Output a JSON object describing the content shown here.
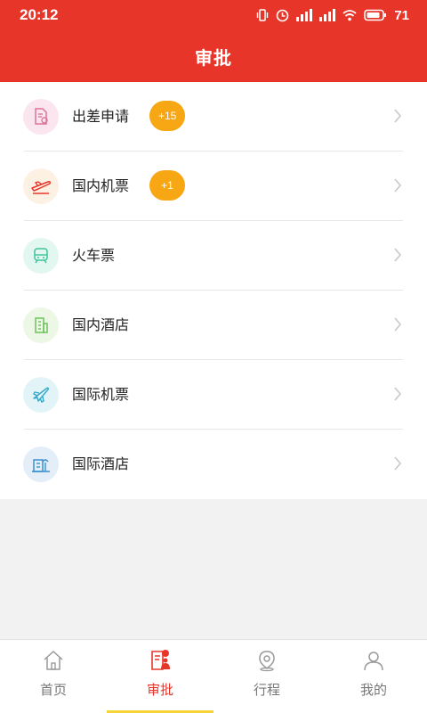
{
  "status_bar": {
    "time": "20:12",
    "battery": "71"
  },
  "header": {
    "title": "审批"
  },
  "items": [
    {
      "label": "出差申请",
      "badge": "+15",
      "icon": "document-stamp-icon",
      "icon_bg": "#fbe6ef",
      "icon_color": "#e0719c"
    },
    {
      "label": "国内机票",
      "badge": "+1",
      "icon": "plane-takeoff-icon",
      "icon_bg": "#fdf1e4",
      "icon_color": "#e8352a"
    },
    {
      "label": "火车票",
      "badge": "",
      "icon": "train-icon",
      "icon_bg": "#e3f7f1",
      "icon_color": "#3cc39a"
    },
    {
      "label": "国内酒店",
      "badge": "",
      "icon": "hotel-building-icon",
      "icon_bg": "#ecf7e6",
      "icon_color": "#6cc35a"
    },
    {
      "label": "国际机票",
      "badge": "",
      "icon": "airplane-icon",
      "icon_bg": "#e3f4f8",
      "icon_color": "#3aa9c9"
    },
    {
      "label": "国际酒店",
      "badge": "",
      "icon": "international-hotel-icon",
      "icon_bg": "#e3eef8",
      "icon_color": "#3b8fd0"
    }
  ],
  "tabs": [
    {
      "label": "首页",
      "icon": "home-icon",
      "active": false
    },
    {
      "label": "审批",
      "icon": "approval-icon",
      "active": true
    },
    {
      "label": "行程",
      "icon": "location-pin-icon",
      "active": false
    },
    {
      "label": "我的",
      "icon": "user-icon",
      "active": false
    }
  ],
  "colors": {
    "brand_red": "#e8352a",
    "badge_orange": "#f7a614",
    "tab_indicator": "#f6d43a"
  }
}
